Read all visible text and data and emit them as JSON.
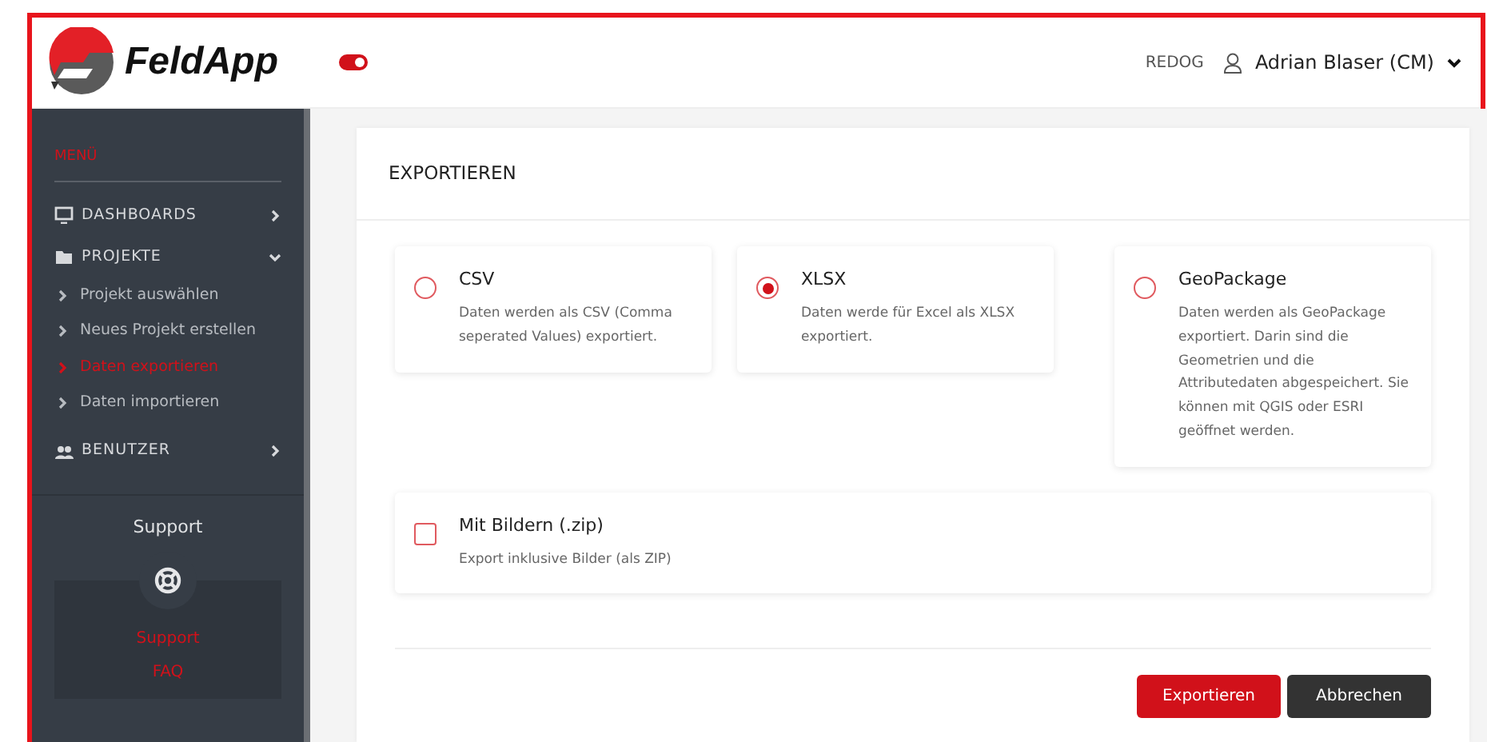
{
  "header": {
    "app_name": "FeldApp",
    "sidebar_toggle": {
      "on": true
    },
    "organization": "REDOG",
    "user": "Adrian Blaser (CM)"
  },
  "sidebar": {
    "menu_title": "MENÜ",
    "items": [
      {
        "label": "DASHBOARDS",
        "expanded": false
      },
      {
        "label": "PROJEKTE",
        "expanded": true,
        "children": [
          {
            "label": "Projekt auswählen",
            "selected": false
          },
          {
            "label": "Neues Projekt erstellen",
            "selected": false
          },
          {
            "label": "Daten exportieren",
            "selected": true
          },
          {
            "label": "Daten importieren",
            "selected": false
          }
        ]
      },
      {
        "label": "BENUTZER",
        "expanded": false
      }
    ],
    "support": {
      "title": "Support",
      "links": [
        "Support",
        "FAQ"
      ]
    }
  },
  "export": {
    "title": "EXPORTIEREN",
    "formats": [
      {
        "name": "CSV",
        "description": "Daten werden als CSV (Comma seperated Values) exportiert.",
        "selected": false
      },
      {
        "name": "XLSX",
        "description": "Daten werde für Excel als XLSX exportiert.",
        "selected": true
      },
      {
        "name": "GeoPackage",
        "description": "Daten werden als GeoPackage exportiert. Darin sind die Geometrien und die Attributedaten abgespeichert. Sie können mit QGIS oder ESRI geöffnet werden.",
        "selected": false
      }
    ],
    "with_images": {
      "name": "Mit Bildern (.zip)",
      "description": "Export inklusive Bilder (als ZIP)",
      "checked": false
    },
    "buttons": [
      {
        "label": "Exportieren",
        "kind": "primary"
      },
      {
        "label": "Abbrechen",
        "kind": "secondary"
      }
    ]
  }
}
